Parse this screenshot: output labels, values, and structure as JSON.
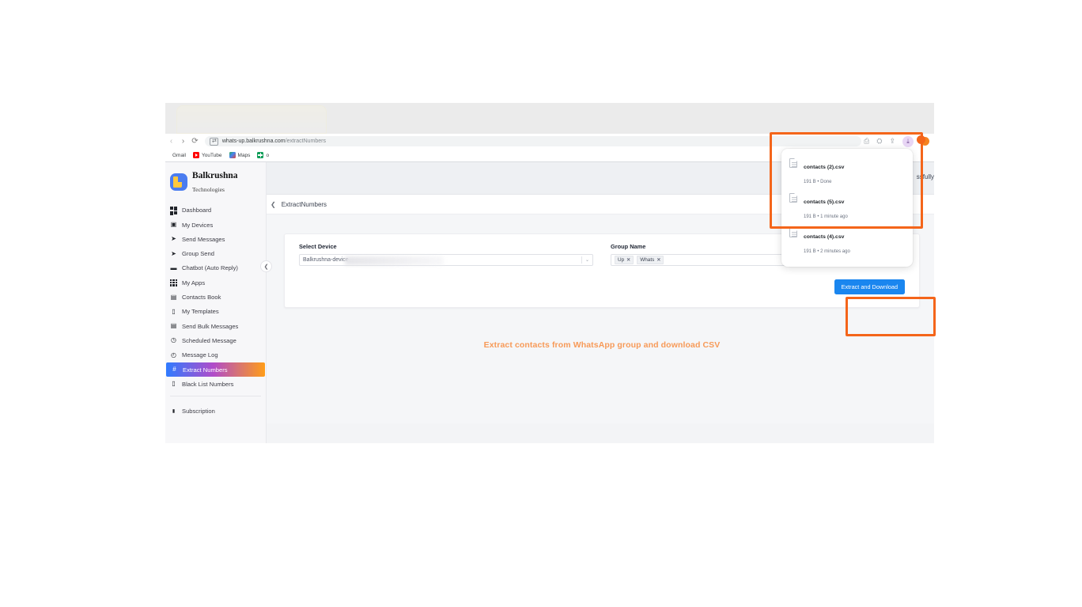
{
  "browser": {
    "nav": {
      "back": "‹",
      "forward": "›",
      "reload": "⟳"
    },
    "url_prefix": "whats-up.balkrushna.com",
    "url_suffix": "/extractNumbers",
    "url_icon_label": "⇄",
    "bookmarks": [
      {
        "label": "Gmail",
        "icon": "gmail-icon"
      },
      {
        "label": "YouTube",
        "icon": "youtube-icon"
      },
      {
        "label": "Maps",
        "icon": "maps-icon"
      },
      {
        "label": "o",
        "icon": "green-plus-icon"
      }
    ],
    "toolbar_icons": [
      {
        "name": "cast-icon",
        "glyph": "⎙"
      },
      {
        "name": "extensions-icon",
        "glyph": "⛭"
      },
      {
        "name": "share-icon",
        "glyph": "⇪"
      },
      {
        "name": "downloads-icon",
        "glyph": "⤓"
      }
    ]
  },
  "downloads": {
    "items": [
      {
        "filename": "contacts (2).csv",
        "meta": "191 B • Done"
      },
      {
        "filename": "contacts (5).csv",
        "meta": "191 B • 1 minute ago"
      },
      {
        "filename": "contacts (4).csv",
        "meta": "191 B • 2 minutes ago"
      }
    ]
  },
  "sidebar": {
    "brand": {
      "name": "Balkrushna",
      "subtitle": "Technologies"
    },
    "collapse_glyph": "❮",
    "items": [
      {
        "label": "Dashboard",
        "icon": "dashboard-grid-icon",
        "glyph": "",
        "active": false
      },
      {
        "label": "My Devices",
        "icon": "devices-icon",
        "glyph": "▣",
        "active": false
      },
      {
        "label": "Send Messages",
        "icon": "send-paper-plane-icon",
        "glyph": "➤",
        "active": false
      },
      {
        "label": "Group Send",
        "icon": "group-send-icon",
        "glyph": "➤",
        "active": false
      },
      {
        "label": "Chatbot (Auto Reply)",
        "icon": "chat-bubble-icon",
        "glyph": "▬",
        "active": false
      },
      {
        "label": "My Apps",
        "icon": "apps-grid-icon",
        "glyph": "",
        "active": false
      },
      {
        "label": "Contacts Book",
        "icon": "contacts-book-icon",
        "glyph": "▤",
        "active": false
      },
      {
        "label": "My Templates",
        "icon": "document-icon",
        "glyph": "▯",
        "active": false
      },
      {
        "label": "Send Bulk Messages",
        "icon": "bulk-message-icon",
        "glyph": "▤",
        "active": false
      },
      {
        "label": "Scheduled Message",
        "icon": "clock-icon",
        "glyph": "◷",
        "active": false
      },
      {
        "label": "Message Log",
        "icon": "history-clock-icon",
        "glyph": "◴",
        "active": false
      },
      {
        "label": "Extract Numbers",
        "icon": "hash-icon",
        "glyph": "#",
        "active": true
      },
      {
        "label": "Black List Numbers",
        "icon": "block-phone-icon",
        "glyph": "▯",
        "active": false
      }
    ],
    "footer_item": {
      "label": "Subscription",
      "icon": "lock-icon",
      "glyph": "🔒"
    }
  },
  "header": {
    "back_glyph": "❮",
    "breadcrumb": "ExtractNumbers",
    "toast_partial": "ssfully"
  },
  "form": {
    "device": {
      "label": "Select Device",
      "value": "Balkrushna-device",
      "chevron": "⌄"
    },
    "group": {
      "label": "Group Name",
      "tags": [
        {
          "label": "Up",
          "remove": "✕"
        },
        {
          "label": "Whats",
          "remove": "✕"
        }
      ],
      "clear": "✕",
      "chevron": "⌄"
    },
    "submit_label": "Extract and Download"
  },
  "caption": "Extract contacts from WhatsApp group and download CSV",
  "colors": {
    "accent_orange": "#f4651a",
    "primary_blue": "#1a86ef",
    "caption_orange": "#f79a58"
  }
}
